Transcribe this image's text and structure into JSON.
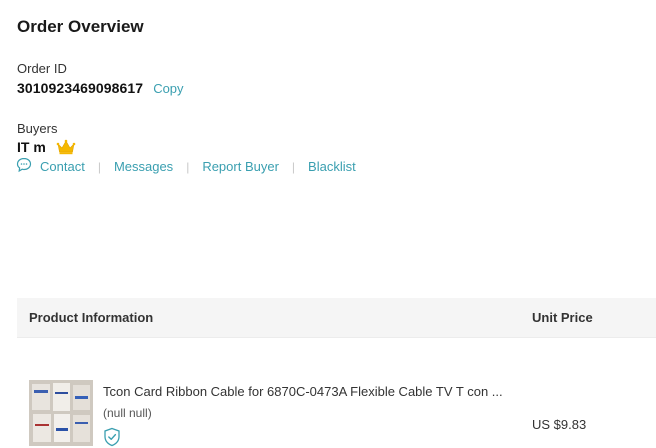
{
  "header": {
    "title": "Order Overview"
  },
  "order": {
    "label": "Order ID",
    "id": "3010923469098617",
    "copy_label": "Copy"
  },
  "buyer": {
    "label": "Buyers",
    "name": "IT m",
    "badge_icon": "crown-icon",
    "badge_color": "#f5b800"
  },
  "actions": {
    "icon": "chat-icon",
    "contact": "Contact",
    "messages": "Messages",
    "report": "Report Buyer",
    "blacklist": "Blacklist",
    "separator": "|"
  },
  "table": {
    "columns": {
      "product": "Product Information",
      "price": "Unit Price"
    },
    "rows": [
      {
        "title": "Tcon Card Ribbon Cable for 6870C-0473A Flexible Cable TV T con ...",
        "sku": "(null null)",
        "verified_icon": "shield-check-icon",
        "price": "US $9.83"
      }
    ]
  },
  "colors": {
    "link": "#3a9fb0",
    "header_bg": "#f5f5f5"
  }
}
